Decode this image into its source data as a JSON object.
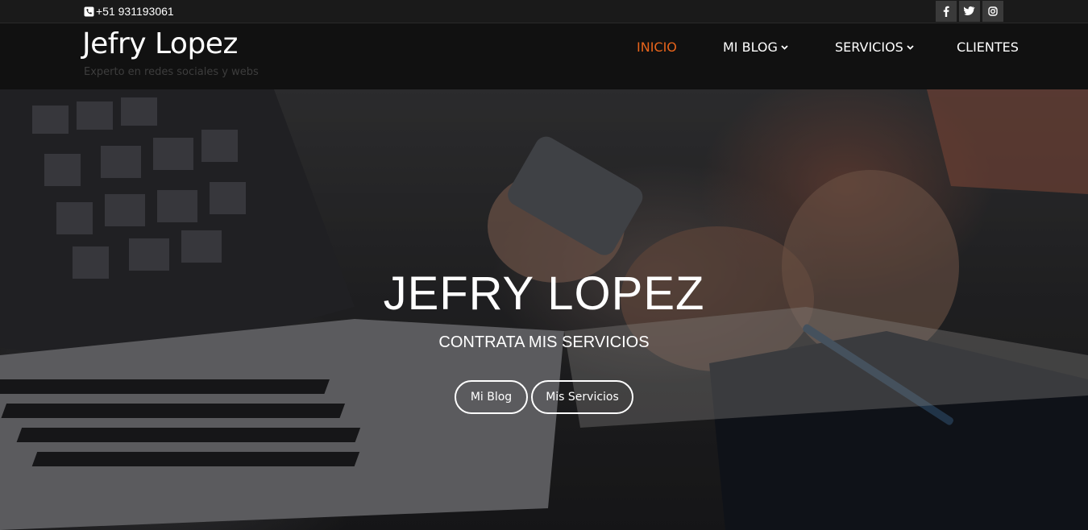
{
  "topbar": {
    "phone": "+51 931193061",
    "phone_icon": "phone-icon",
    "social": [
      {
        "name": "facebook",
        "icon": "facebook-icon"
      },
      {
        "name": "twitter",
        "icon": "twitter-icon"
      },
      {
        "name": "instagram",
        "icon": "instagram-icon"
      }
    ]
  },
  "header": {
    "brand": "Jefry Lopez",
    "tagline": "Experto en redes sociales y webs",
    "nav": [
      {
        "label": "INICIO",
        "active": true
      },
      {
        "label": "MI BLOG",
        "dropdown": true
      },
      {
        "label": "SERVICIOS",
        "dropdown": true
      },
      {
        "label": "CLIENTES"
      }
    ]
  },
  "hero": {
    "title": "JEFRY LOPEZ",
    "subtitle": "CONTRATA MIS SERVICIOS",
    "buttons": [
      "Mi Blog",
      "Mis Servicios"
    ]
  },
  "colors": {
    "accent": "#e8641b",
    "topbar_bg": "#1a1a1a",
    "header_bg": "#111111"
  }
}
